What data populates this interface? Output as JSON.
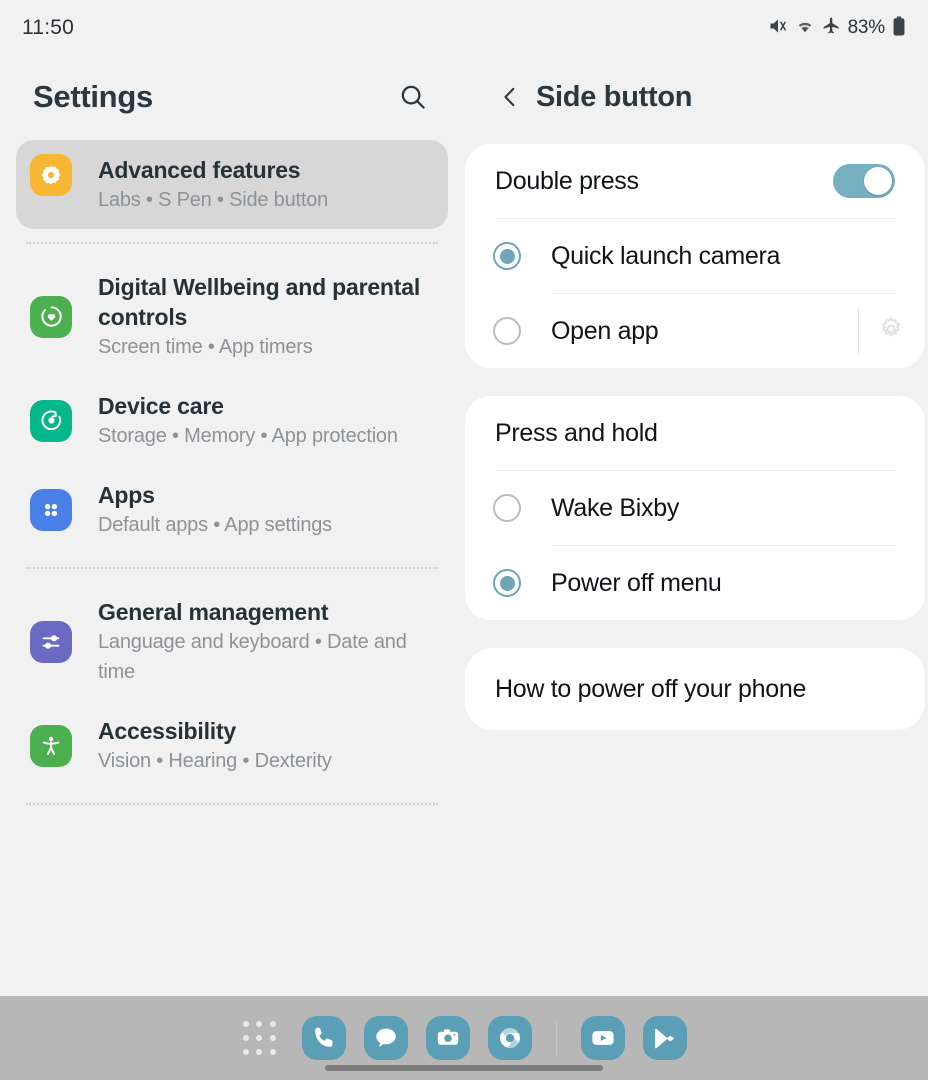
{
  "status_bar": {
    "time": "11:50",
    "battery_percent": "83%",
    "icons": [
      "mute-icon",
      "wifi-icon",
      "airplane-mode-icon",
      "battery-icon"
    ]
  },
  "sidebar": {
    "title": "Settings",
    "search_icon": "search-icon",
    "items": [
      {
        "id": "advanced-features",
        "title": "Advanced features",
        "subtitle": "Labs  •  S Pen  •  Side button",
        "icon": "advanced-features-icon",
        "icon_color": "#f7b733",
        "selected": true
      },
      {
        "id": "digital-wellbeing",
        "title": "Digital Wellbeing and parental controls",
        "subtitle": "Screen time  •  App timers",
        "icon": "digital-wellbeing-icon",
        "icon_color": "#4caf50",
        "selected": false
      },
      {
        "id": "device-care",
        "title": "Device care",
        "subtitle": "Storage  •  Memory  •  App protection",
        "icon": "device-care-icon",
        "icon_color": "#05b68a",
        "selected": false
      },
      {
        "id": "apps",
        "title": "Apps",
        "subtitle": "Default apps  •  App settings",
        "icon": "apps-icon",
        "icon_color": "#4a7fe8",
        "selected": false
      },
      {
        "id": "general-management",
        "title": "General management",
        "subtitle": "Language and keyboard  •  Date and time",
        "icon": "general-management-icon",
        "icon_color": "#6a6ac2",
        "selected": false
      },
      {
        "id": "accessibility",
        "title": "Accessibility",
        "subtitle": "Vision  •  Hearing  •  Dexterity",
        "icon": "accessibility-icon",
        "icon_color": "#4caf50",
        "selected": false
      }
    ]
  },
  "detail": {
    "back_icon": "chevron-left-icon",
    "title": "Side button",
    "double_press": {
      "label": "Double press",
      "toggle_on": true,
      "options": [
        {
          "label": "Quick launch camera",
          "selected": true,
          "has_settings": false
        },
        {
          "label": "Open app",
          "selected": false,
          "has_settings": true,
          "settings_icon": "gear-icon"
        }
      ]
    },
    "press_and_hold": {
      "label": "Press and hold",
      "options": [
        {
          "label": "Wake Bixby",
          "selected": false
        },
        {
          "label": "Power off menu",
          "selected": true
        }
      ]
    },
    "howto": {
      "label": "How to power off your phone"
    }
  },
  "taskbar": {
    "app_drawer_icon": "app-drawer-icon",
    "apps": [
      {
        "name": "phone-icon"
      },
      {
        "name": "messages-icon"
      },
      {
        "name": "camera-icon"
      },
      {
        "name": "chrome-icon"
      }
    ],
    "recent": [
      {
        "name": "youtube-icon"
      },
      {
        "name": "play-store-icon"
      }
    ]
  },
  "colors": {
    "accent_teal": "#6fa5b7",
    "page_bg": "#f1f1f1",
    "card_bg": "#ffffff",
    "selected_bg": "#d7d7d7",
    "taskbar_bg": "#b7b7b7",
    "title_text": "#2b383f",
    "subtitle_text": "#8d9296"
  }
}
